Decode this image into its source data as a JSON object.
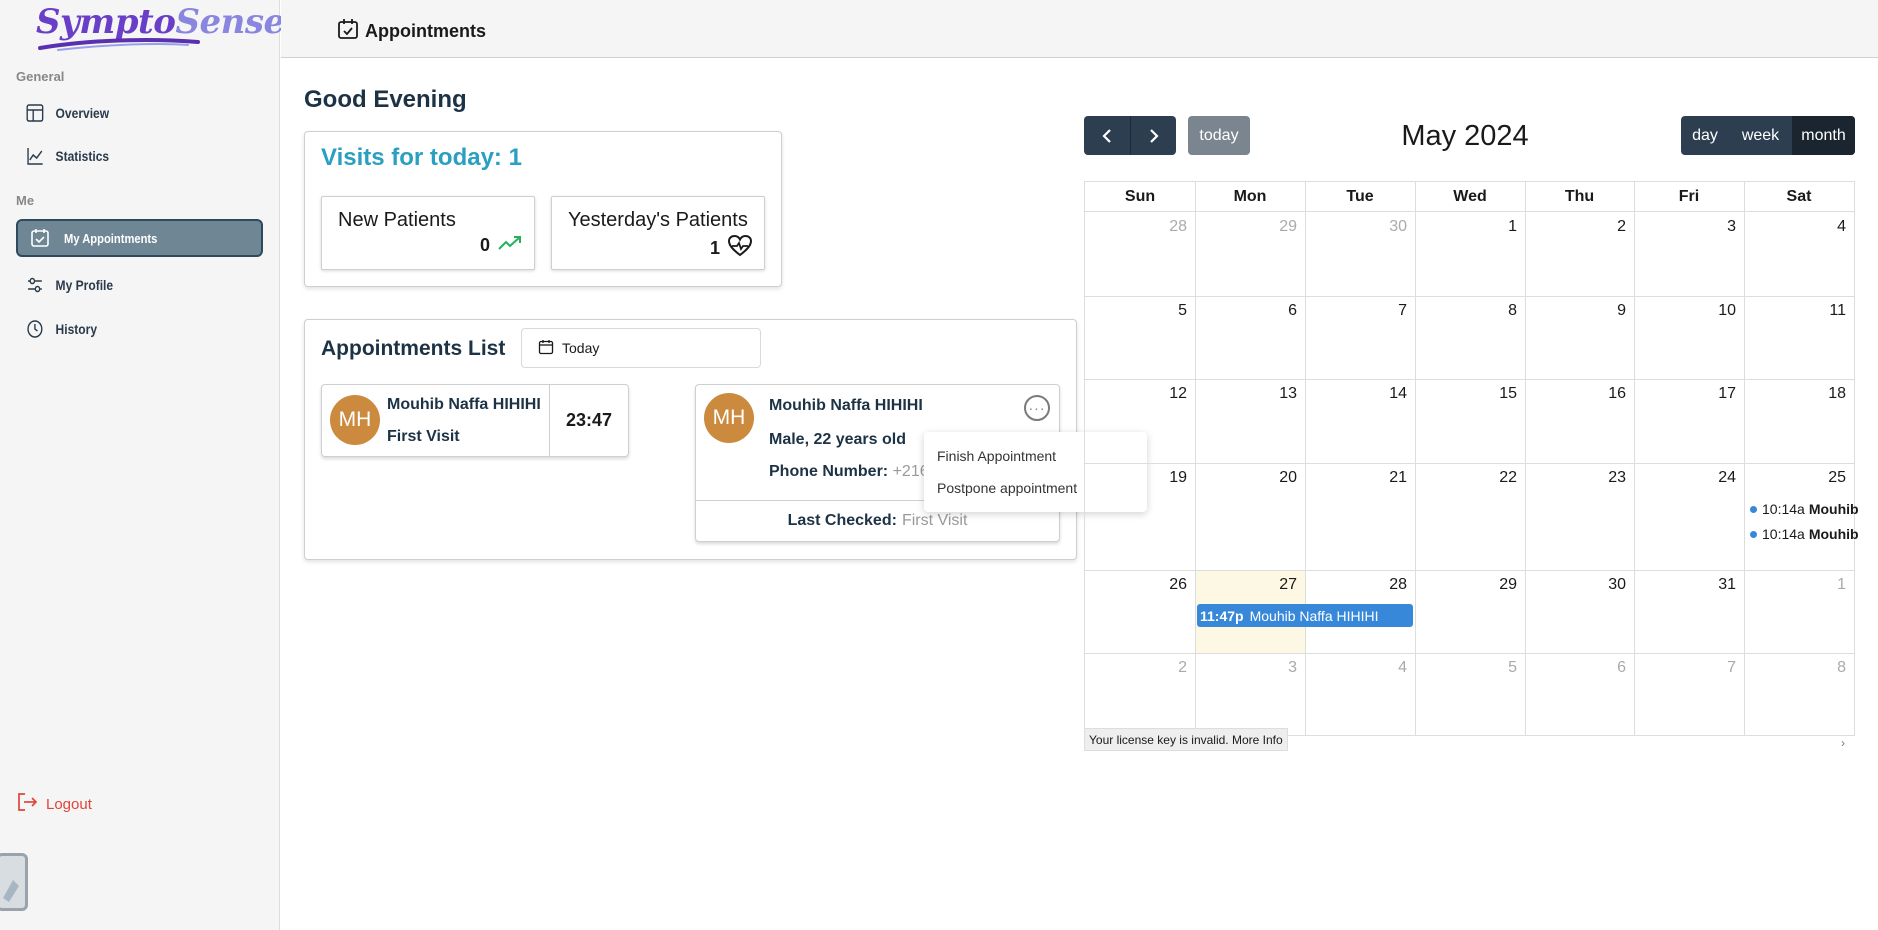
{
  "app": {
    "logo_text_a": "Sympto",
    "logo_text_b": "Sense"
  },
  "sidebar": {
    "section_general": "General",
    "section_me": "Me",
    "items": [
      {
        "label": "Overview",
        "icon": "layout-icon"
      },
      {
        "label": "Statistics",
        "icon": "line-chart-icon"
      },
      {
        "label": "My Appointments",
        "icon": "calendar-check-icon",
        "active": true
      },
      {
        "label": "My Profile",
        "icon": "sliders-icon"
      },
      {
        "label": "History",
        "icon": "clock-icon"
      }
    ],
    "logout": "Logout"
  },
  "header": {
    "title": "Appointments"
  },
  "greeting": "Good Evening",
  "visits": {
    "title": "Visits for today: 1",
    "new_patients": {
      "label": "New Patients",
      "value": "0"
    },
    "yesterday_patients": {
      "label": "Yesterday's Patients",
      "value": "1"
    }
  },
  "appointments": {
    "title": "Appointments List",
    "date_filter": "Today",
    "cards": [
      {
        "initials": "MH",
        "name": "Mouhib Naffa HIHIHI",
        "visit": "First Visit",
        "time": "23:47"
      },
      {
        "initials": "MH",
        "name": "Mouhib Naffa HIHIHI",
        "gender_age": "Male, 22 years old",
        "phone_label": "Phone Number:",
        "phone_value": "+216",
        "last_checked_label": "Last Checked:",
        "last_checked_value": "First Visit"
      }
    ],
    "menu": [
      "Finish Appointment",
      "Postpone appointment"
    ]
  },
  "calendar": {
    "title": "May 2024",
    "today_label": "today",
    "views": [
      "day",
      "week",
      "month"
    ],
    "active_view": "month",
    "weekdays": [
      "Sun",
      "Mon",
      "Tue",
      "Wed",
      "Thu",
      "Fri",
      "Sat"
    ],
    "weeks": [
      [
        "28",
        "29",
        "30",
        "1",
        "2",
        "3",
        "4"
      ],
      [
        "5",
        "6",
        "7",
        "8",
        "9",
        "10",
        "11"
      ],
      [
        "12",
        "13",
        "14",
        "15",
        "16",
        "17",
        "18"
      ],
      [
        "19",
        "20",
        "21",
        "22",
        "23",
        "24",
        "25"
      ],
      [
        "26",
        "27",
        "28",
        "29",
        "30",
        "31",
        "1"
      ],
      [
        "2",
        "3",
        "4",
        "5",
        "6",
        "7",
        "8"
      ]
    ],
    "events": [
      {
        "time": "10:14a",
        "title": "Mouhib"
      },
      {
        "time": "10:14a",
        "title": "Mouhib"
      },
      {
        "time": "11:47p",
        "title": "Mouhib Naffa HIHIHI"
      }
    ],
    "license_notice": "Your license key is invalid. More Info"
  },
  "colors": {
    "accent": "#2a9fc2",
    "nav_active": "#6f8695",
    "calendar_dark": "#2c3e50",
    "event_blue": "#3788d8",
    "logout_red": "#e0453a"
  }
}
